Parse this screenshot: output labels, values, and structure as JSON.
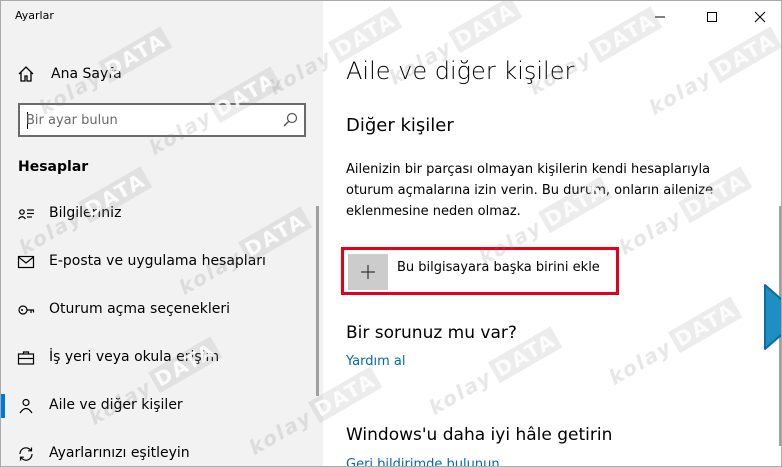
{
  "app": {
    "title": "Ayarlar"
  },
  "sidebar": {
    "home_label": "Ana Sayfa",
    "search_placeholder": "Bir ayar bulun",
    "section_title": "Hesaplar",
    "items": [
      {
        "label": "Bilgileriniz",
        "icon": "user-card-icon",
        "selected": false
      },
      {
        "label": "E-posta ve uygulama hesapları",
        "icon": "mail-icon",
        "selected": false
      },
      {
        "label": "Oturum açma seçenekleri",
        "icon": "key-icon",
        "selected": false
      },
      {
        "label": "İş yeri veya okula erişim",
        "icon": "briefcase-icon",
        "selected": false
      },
      {
        "label": "Aile ve diğer kişiler",
        "icon": "person-icon",
        "selected": true
      },
      {
        "label": "Ayarlarınızı eşitleyin",
        "icon": "sync-icon",
        "selected": false
      }
    ]
  },
  "main": {
    "title": "Aile ve diğer kişiler",
    "other_people": {
      "title": "Diğer kişiler",
      "description": "Ailenizin bir parçası olmayan kişilerin kendi hesaplarıyla oturum açmalarına izin verin. Bu durum, onların ailenize eklenmesine neden olmaz.",
      "add_button_label": "Bu bilgisayara başka birini ekle"
    },
    "help": {
      "title": "Bir sorunuz mu var?",
      "link": "Yardım al"
    },
    "improve": {
      "title": "Windows'u daha iyi hâle getirin",
      "link": "Geri bildirimde bulunun"
    }
  },
  "window_controls": [
    "minimize-icon",
    "maximize-icon",
    "close-icon"
  ],
  "watermark": {
    "text": "kolay",
    "badge": "DATA"
  },
  "colors": {
    "accent": "#0078d7",
    "link": "#0067b8",
    "highlight_border": "#e3001b",
    "cursor": "#1e8fc4",
    "sidebar_bg": "#f2f2f2"
  }
}
